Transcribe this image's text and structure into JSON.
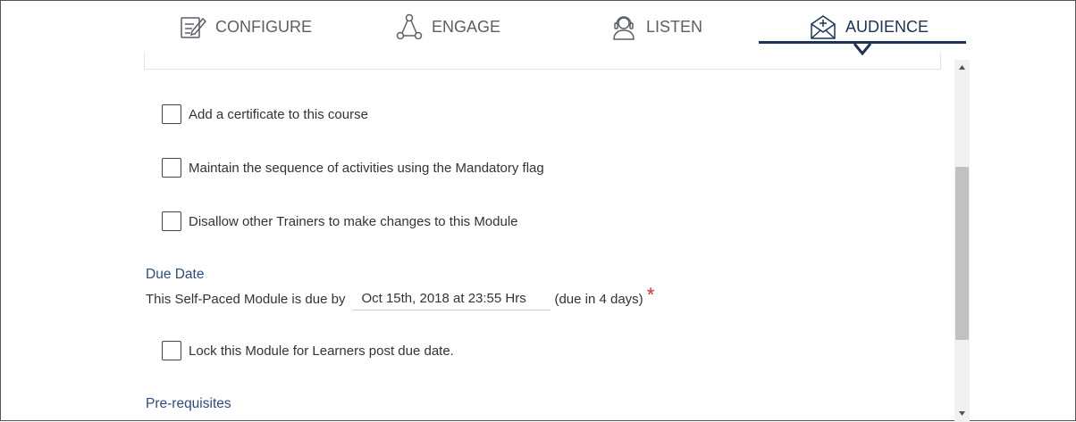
{
  "tabs": [
    {
      "label": "CONFIGURE",
      "icon": "edit-icon",
      "active": false
    },
    {
      "label": "ENGAGE",
      "icon": "network-icon",
      "active": false
    },
    {
      "label": "LISTEN",
      "icon": "headset-icon",
      "active": false
    },
    {
      "label": "AUDIENCE",
      "icon": "mail-add-icon",
      "active": true
    }
  ],
  "options": {
    "certificate": {
      "label": "Add a certificate to this course",
      "checked": false
    },
    "sequence": {
      "label": "Maintain the sequence of activities using the Mandatory flag",
      "checked": false
    },
    "disallow": {
      "label": "Disallow other Trainers to make changes to this Module",
      "checked": false
    },
    "lock": {
      "label": "Lock this Module for Learners post due date.",
      "checked": false
    }
  },
  "due_date": {
    "title": "Due Date",
    "prefix": "This Self-Paced Module is due by",
    "value": "Oct 15th, 2018 at 23:55 Hrs",
    "note": "(due in 4 days)",
    "required_mark": "*"
  },
  "prerequisites": {
    "title": "Pre-requisites"
  },
  "colors": {
    "accent": "#1c3356",
    "section_title": "#2b4c7e",
    "required": "#d9262c"
  }
}
